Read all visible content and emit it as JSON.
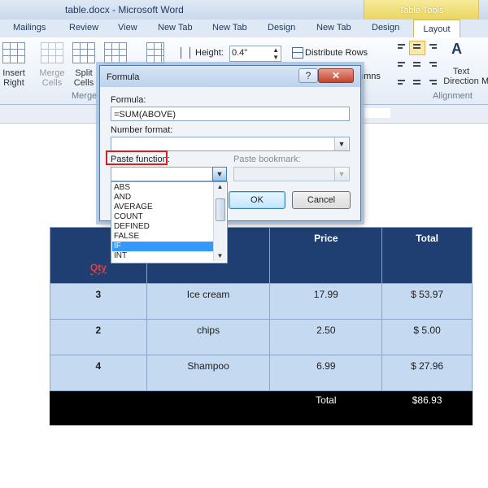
{
  "window": {
    "title": "table.docx - Microsoft Word",
    "context_tab_group": "Table Tools"
  },
  "tabs": [
    "Mailings",
    "Review",
    "View",
    "New Tab",
    "New Tab",
    "Design",
    "New Tab",
    "Design",
    "Layout"
  ],
  "ribbon": {
    "insert_right_line1": "Insert",
    "insert_right_line2": "Right",
    "merge_cells_line1": "Merge",
    "merge_cells_line2": "Cells",
    "split_cells_line1": "Split",
    "split_cells_line2": "Cells",
    "group_merge": "Merge",
    "height_label": "Height:",
    "height_value": "0.4\"",
    "distribute_rows": "Distribute Rows",
    "columns_fragment": "umns",
    "text_direction_line1": "Text",
    "text_direction_line2": "Direction",
    "cell_margins_fragment": "M",
    "group_alignment": "Alignment"
  },
  "dialog": {
    "title": "Formula",
    "help": "?",
    "close": "✕",
    "formula_label": "Formula:",
    "formula_value": "=SUM(ABOVE)",
    "number_format_label": "Number format:",
    "number_format_value": "",
    "paste_function_label": "Paste function:",
    "paste_function_value": "",
    "paste_bookmark_label": "Paste bookmark:",
    "paste_bookmark_value": "",
    "ok": "OK",
    "cancel": "Cancel",
    "functions": [
      "ABS",
      "AND",
      "AVERAGE",
      "COUNT",
      "DEFINED",
      "FALSE",
      "IF",
      "INT"
    ],
    "selected_function": "IF"
  },
  "table": {
    "headers": [
      "Qty",
      "",
      "Price",
      "Total"
    ],
    "rows": [
      [
        "3",
        "Ice cream",
        "17.99",
        "$  53.97"
      ],
      [
        "2",
        "chips",
        "2.50",
        "$   5.00"
      ],
      [
        "4",
        "Shampoo",
        "6.99",
        "$  27.96"
      ]
    ],
    "total_label": "Total",
    "total_value": "$86.93"
  },
  "colors": {
    "table_header": "#1f3f72",
    "table_rows": "#c5d9f1",
    "highlight_box": "#d81e1e",
    "selection": "#3399ff"
  }
}
